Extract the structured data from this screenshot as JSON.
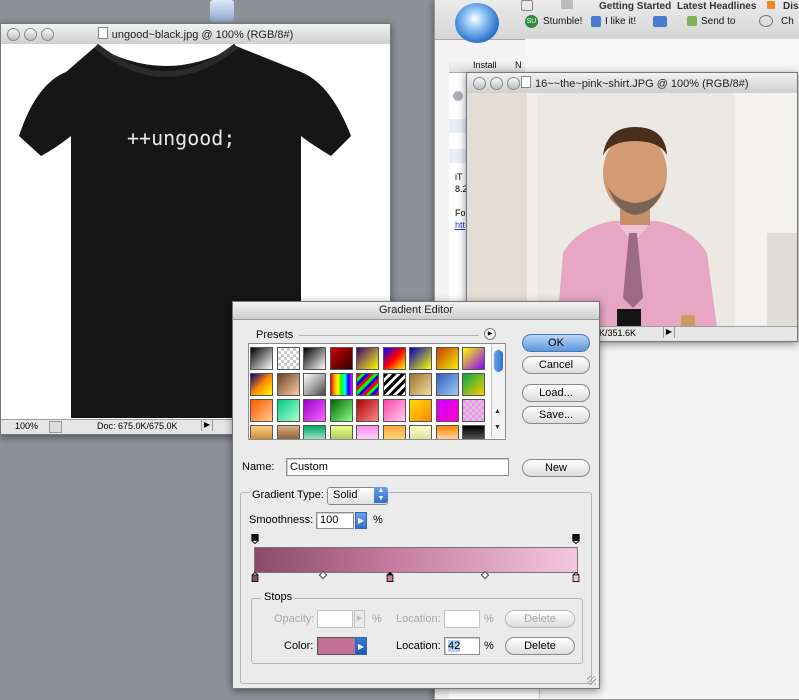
{
  "doc1": {
    "title": "ungood~black.jpg @ 100% (RGB/8#)",
    "shirt_text": "++ungood;",
    "zoom": "100%",
    "doc_size": "Doc: 675.0K/675.0K"
  },
  "browser": {
    "bookmarks": [
      "Getting Started",
      "Latest Headlines",
      "Disney"
    ],
    "toolbar": [
      "Stumble!",
      "I like it!",
      "Send to",
      "Ch"
    ],
    "column_install": "Install",
    "column_n": "N",
    "partial_texts": [
      "iT",
      "8.2",
      "Fo",
      "htt"
    ]
  },
  "doc2": {
    "title": "16~~the~pink~shirt.JPG @ 100% (RGB/8#)",
    "doc_size": "K/351.6K"
  },
  "gradient_editor": {
    "title": "Gradient Editor",
    "presets_label": "Presets",
    "ok": "OK",
    "cancel": "Cancel",
    "load": "Load...",
    "save": "Save...",
    "name_label": "Name:",
    "name_value": "Custom",
    "new": "New",
    "type_label": "Gradient Type:",
    "type_value": "Solid",
    "smoothness_label": "Smoothness:",
    "smoothness_value": "100",
    "percent": "%",
    "stops_label": "Stops",
    "opacity_label": "Opacity:",
    "location_label": "Location:",
    "delete": "Delete",
    "color_label": "Color:",
    "color_location_value": "42",
    "gradient_start": "#8a4a68",
    "gradient_mid": "#c47a9e",
    "gradient_end": "#f2c8de",
    "selected_color": "#c27096"
  }
}
